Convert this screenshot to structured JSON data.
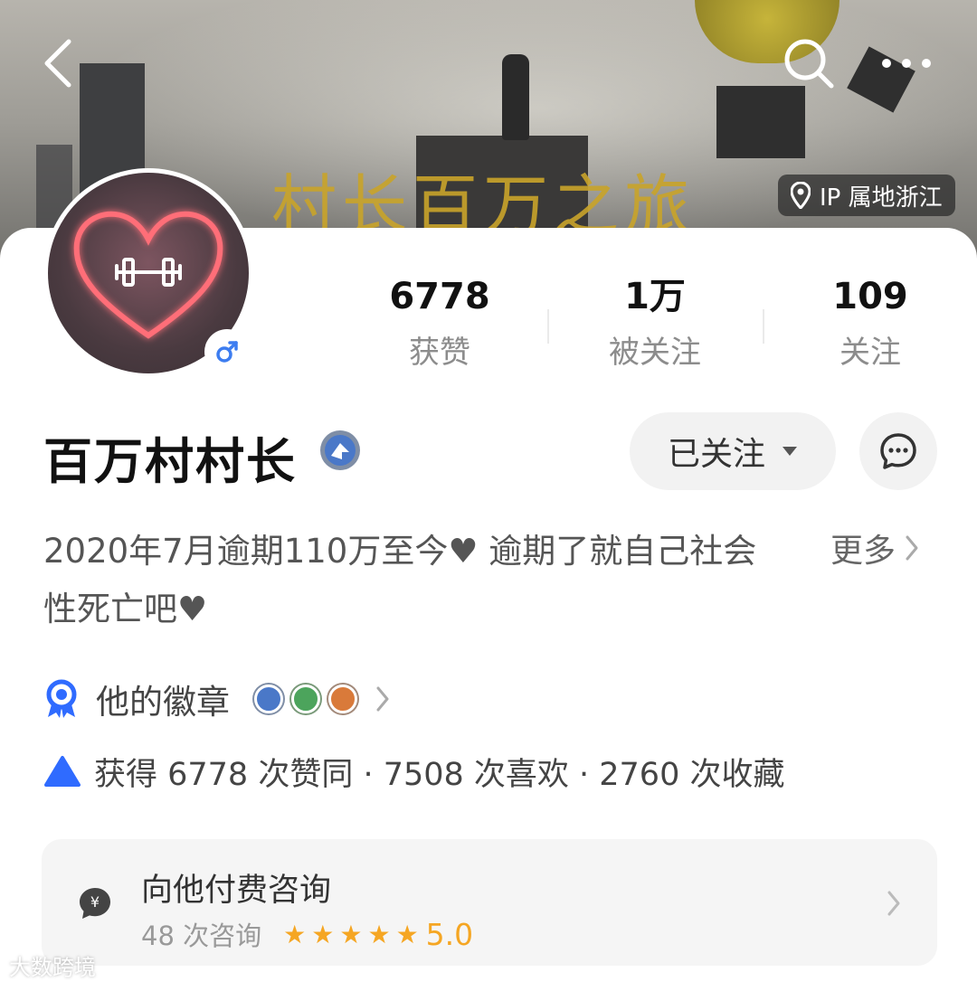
{
  "banner": {
    "title": "村长百万之旅",
    "ip_location": "IP 属地浙江"
  },
  "header": {
    "back_icon": "chevron-left-icon",
    "search_icon": "search-icon",
    "more_icon": "more-dots-icon"
  },
  "profile": {
    "name": "百万村村长",
    "gender_icon": "male-icon",
    "verify_icon": "verified-badge-icon"
  },
  "stats": [
    {
      "value": "6778",
      "label": "获赞"
    },
    {
      "value": "1万",
      "label": "被关注"
    },
    {
      "value": "109",
      "label": "关注"
    }
  ],
  "actions": {
    "follow_label": "已关注",
    "message_icon": "chat-icon"
  },
  "bio": {
    "text": "2020年7月逾期110万至今♥ 逾期了就自己社会性死亡吧♥",
    "more_label": "更多"
  },
  "badges": {
    "label": "他的徽章",
    "colors": [
      "#4a78c8",
      "#4ca45c",
      "#d97a3a"
    ]
  },
  "achievements": {
    "text": "获得 6778 次赞同 · 7508 次喜欢 · 2760 次收藏",
    "accent": "#2f6bff"
  },
  "consult": {
    "title": "向他付费咨询",
    "count": "48 次咨询",
    "rating": "5.0",
    "stars": 5
  },
  "watermark": "大数跨境"
}
